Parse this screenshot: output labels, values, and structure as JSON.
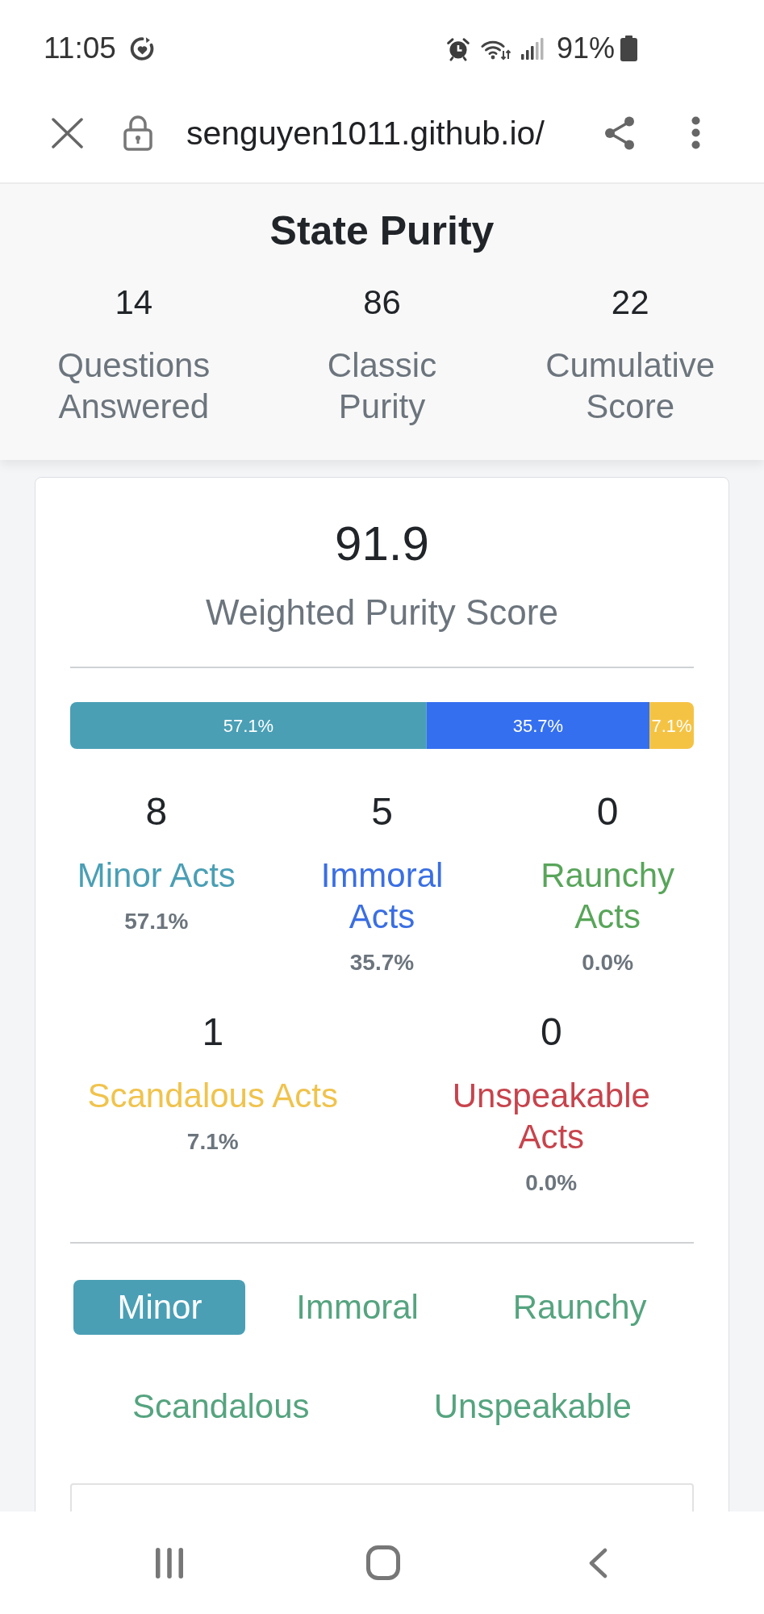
{
  "status_bar": {
    "time": "11:05",
    "battery": "91%"
  },
  "browser_bar": {
    "url": "senguyen1011.github.io/"
  },
  "header": {
    "title": "State Purity",
    "stats": [
      {
        "value": "14",
        "label": "Questions Answered"
      },
      {
        "value": "86",
        "label": "Classic Purity"
      },
      {
        "value": "22",
        "label": "Cumulative Score"
      }
    ]
  },
  "score_card": {
    "score": "91.9",
    "score_label": "Weighted Purity Score",
    "breakdown_chart": {
      "chart_data": {
        "type": "bar",
        "orientation": "horizontal",
        "stacked": true,
        "series": [
          {
            "color": "#4a9fb5",
            "values": [
              57.1
            ],
            "value_labels": [
              "57.1%"
            ]
          },
          {
            "color": "#346ff0",
            "values": [
              35.7
            ],
            "value_labels": [
              "35.7%"
            ]
          },
          {
            "color": "#f5c344",
            "values": [
              7.1
            ],
            "value_labels": [
              "7.1%"
            ]
          }
        ]
      }
    },
    "categories": [
      {
        "count": "8",
        "name": "Minor Acts",
        "percent": "57.1%",
        "color": "#4a9fb5"
      },
      {
        "count": "5",
        "name": "Immoral Acts",
        "percent": "35.7%",
        "color": "#3a6fe3"
      },
      {
        "count": "0",
        "name": "Raunchy Acts",
        "percent": "0.0%",
        "color": "#58a55a"
      },
      {
        "count": "1",
        "name": "Scandalous Acts",
        "percent": "7.1%",
        "color": "#f0c34c"
      },
      {
        "count": "0",
        "name": "Unspeakable Acts",
        "percent": "0.0%",
        "color": "#c8434c"
      }
    ],
    "tabs": [
      {
        "label": "Minor",
        "selected": true
      },
      {
        "label": "Immoral",
        "selected": false
      },
      {
        "label": "Raunchy",
        "selected": false
      },
      {
        "label": "Scandalous",
        "selected": false
      },
      {
        "label": "Unspeakable",
        "selected": false
      }
    ]
  }
}
